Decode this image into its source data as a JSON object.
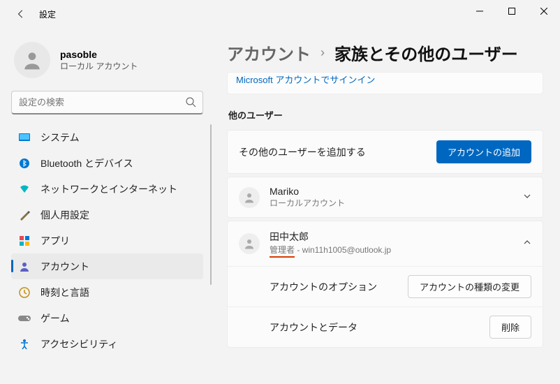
{
  "window": {
    "title": "設定"
  },
  "profile": {
    "name": "pasoble",
    "sub": "ローカル アカウント"
  },
  "search": {
    "placeholder": "設定の検索"
  },
  "nav": [
    {
      "label": "システム",
      "icon": "system"
    },
    {
      "label": "Bluetooth とデバイス",
      "icon": "bluetooth"
    },
    {
      "label": "ネットワークとインターネット",
      "icon": "network"
    },
    {
      "label": "個人用設定",
      "icon": "personalize"
    },
    {
      "label": "アプリ",
      "icon": "apps"
    },
    {
      "label": "アカウント",
      "icon": "accounts",
      "active": true
    },
    {
      "label": "時刻と言語",
      "icon": "time"
    },
    {
      "label": "ゲーム",
      "icon": "gaming"
    },
    {
      "label": "アクセシビリティ",
      "icon": "accessibility"
    }
  ],
  "breadcrumb": {
    "parent": "アカウント",
    "current": "家族とその他のユーザー"
  },
  "ms_link": "Microsoft アカウントでサインイン",
  "other_users_label": "他のユーザー",
  "add_row": {
    "text": "その他のユーザーを追加する",
    "button": "アカウントの追加"
  },
  "users": [
    {
      "name": "Mariko",
      "sub": "ローカルアカウント",
      "expanded": false
    },
    {
      "name": "田中太郎",
      "role": "管理者",
      "email": "win11h1005@outlook.jp",
      "expanded": true,
      "options": [
        {
          "label": "アカウントのオプション",
          "button": "アカウントの種類の変更"
        },
        {
          "label": "アカウントとデータ",
          "button": "削除"
        }
      ]
    }
  ]
}
